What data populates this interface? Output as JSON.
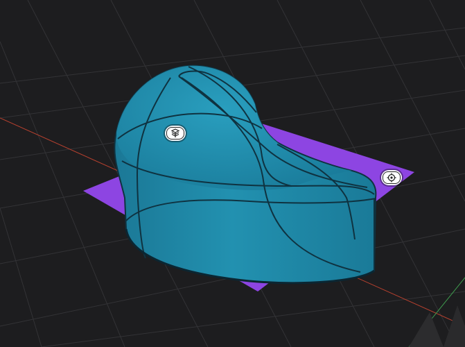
{
  "viewport": {
    "background": "#1d1d1f",
    "grid_color": "#3a3a3c",
    "axis_x_color": "#c0392b",
    "axis_y_color": "#3c9a4a"
  },
  "scene": {
    "ground_plane": {
      "color": "#8e44e0"
    },
    "solid": {
      "color": "#1f87a6",
      "edge_color": "#0f3240",
      "highlight": "#3aa7c6"
    }
  },
  "gizmos": [
    {
      "name": "object-transform-gizmo",
      "icon": "cube-layers-icon"
    },
    {
      "name": "target-gizmo",
      "icon": "crosshair-icon"
    }
  ]
}
